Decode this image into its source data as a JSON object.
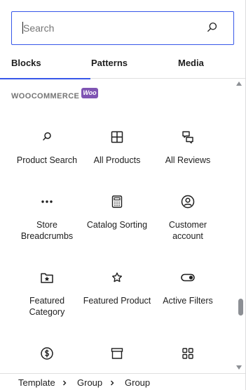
{
  "search": {
    "placeholder": "Search",
    "value": ""
  },
  "tabs": [
    {
      "label": "Blocks",
      "active": true
    },
    {
      "label": "Patterns",
      "active": false
    },
    {
      "label": "Media",
      "active": false
    }
  ],
  "category": {
    "title": "WOOCOMMERCE",
    "badge": "Woo",
    "badge_color": "#7f54b3"
  },
  "blocks": [
    {
      "label": "Product Search",
      "icon": "search-icon"
    },
    {
      "label": "All Products",
      "icon": "grid-icon"
    },
    {
      "label": "All Reviews",
      "icon": "comment-reviews-icon"
    },
    {
      "label": "Store Breadcrumbs",
      "icon": "more-horizontal-icon"
    },
    {
      "label": "Catalog Sorting",
      "icon": "calculator-icon"
    },
    {
      "label": "Customer account",
      "icon": "user-circle-icon"
    },
    {
      "label": "Featured Category",
      "icon": "folder-star-icon"
    },
    {
      "label": "Featured Product",
      "icon": "star-icon"
    },
    {
      "label": "Active Filters",
      "icon": "toggle-icon"
    },
    {
      "label": "",
      "icon": "dollar-circle-icon"
    },
    {
      "label": "",
      "icon": "archive-icon"
    },
    {
      "label": "",
      "icon": "grid-four-icon"
    }
  ],
  "breadcrumb": [
    "Template",
    "Group",
    "Group"
  ],
  "colors": {
    "accent": "#3858e9",
    "text": "#1e1e1e",
    "muted": "#757575"
  }
}
